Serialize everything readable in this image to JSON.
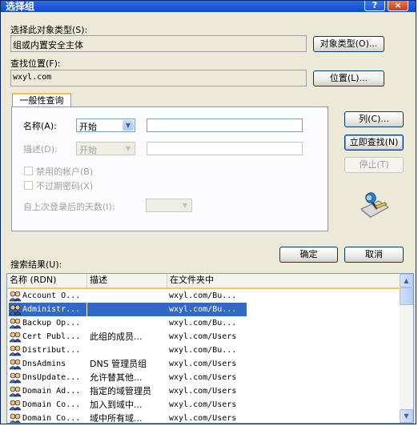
{
  "window": {
    "title": "选择组",
    "help": "?",
    "close": "×"
  },
  "object_types": {
    "label": "选择此对象类型(S):",
    "value": "组或内置安全主体",
    "button": "对象类型(O)..."
  },
  "location": {
    "label": "查找位置(F):",
    "value": "wxyl.com",
    "button": "位置(L)..."
  },
  "tab": {
    "label": "一般性查询"
  },
  "query": {
    "name_label": "名称(A):",
    "name_mode": "开始",
    "name_value": "",
    "desc_label": "描述(D):",
    "desc_mode": "开始",
    "desc_value": "",
    "disabled_accounts": "禁用的帐户(B)",
    "non_expiring": "不过期密码(X)",
    "days_label": "自上次登录后的天数(I):",
    "days_value": ""
  },
  "side_buttons": {
    "columns": "列(C)...",
    "find_now": "立即查找(N)",
    "stop": "停止(T)"
  },
  "dialog_buttons": {
    "ok": "确定",
    "cancel": "取消"
  },
  "results": {
    "label": "搜索结果(U):",
    "columns": [
      "名称 (RDN)",
      "描述",
      "在文件夹中"
    ],
    "rows": [
      {
        "name": "Account O...",
        "desc": "",
        "folder": "wxyl.com/Bu..."
      },
      {
        "name": "Administr...",
        "desc": "",
        "folder": "wxyl.com/Bu...",
        "selected": true
      },
      {
        "name": "Backup Op...",
        "desc": "",
        "folder": "wxyl.com/Bu..."
      },
      {
        "name": "Cert Publ...",
        "desc": "此组的成员...",
        "folder": "wxyl.com/Users"
      },
      {
        "name": "Distribut...",
        "desc": "",
        "folder": "wxyl.com/Bu..."
      },
      {
        "name": "DnsAdmins",
        "desc": "DNS 管理员组",
        "folder": "wxyl.com/Users"
      },
      {
        "name": "DnsUpdate...",
        "desc": "允许替其他...",
        "folder": "wxyl.com/Users"
      },
      {
        "name": "Domain Ad...",
        "desc": "指定的域管理员",
        "folder": "wxyl.com/Users"
      },
      {
        "name": "Domain Co...",
        "desc": "加入到域中...",
        "folder": "wxyl.com/Users"
      },
      {
        "name": "Domain Co...",
        "desc": "域中所有域...",
        "folder": "wxyl.com/Users"
      }
    ]
  }
}
